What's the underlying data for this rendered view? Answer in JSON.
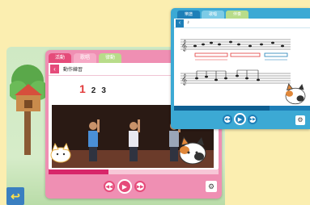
{
  "pink_window": {
    "tabs": [
      {
        "label": "活動",
        "active": true
      },
      {
        "label": "歌唱",
        "active": false
      },
      {
        "label": "律動",
        "active": false
      }
    ],
    "header_title": "動作練習",
    "step_numbers": [
      "1",
      "2",
      "3"
    ],
    "progress": 0.35,
    "controls": [
      "prev-icon",
      "play-icon",
      "next-icon"
    ],
    "settings_icon": "⚙"
  },
  "blue_window": {
    "tabs": [
      {
        "label": "樂譜",
        "active": true
      },
      {
        "label": "歌唱",
        "active": false
      },
      {
        "label": "伴奏",
        "active": false
      }
    ],
    "header_label": "♪",
    "progress": 0.7,
    "controls": [
      "prev-icon",
      "play-icon",
      "next-icon"
    ],
    "settings_icon": "⚙"
  },
  "back_button_glyph": "↩",
  "colors": {
    "pink_accent": "#e54b7a",
    "blue_accent": "#1e7fb8",
    "background": "#fbeeb0"
  }
}
